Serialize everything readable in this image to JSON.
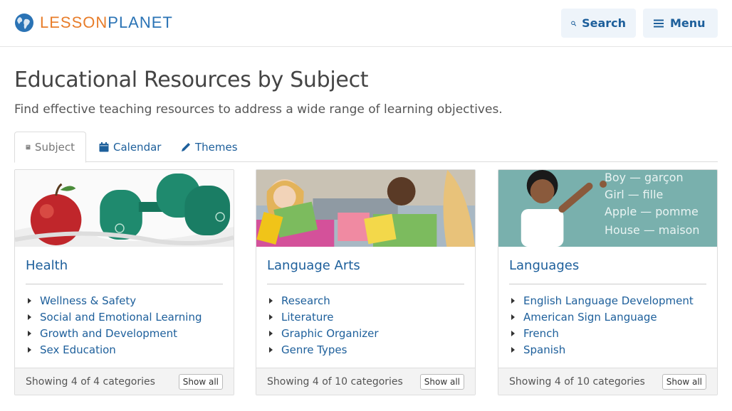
{
  "header": {
    "logo_word1": "LESSON",
    "logo_word2": "PLANET",
    "search_label": "Search",
    "menu_label": "Menu"
  },
  "page": {
    "title": "Educational Resources by Subject",
    "subtitle": "Find effective teaching resources to address a wide range of learning objectives."
  },
  "tabs": [
    {
      "label": "Subject",
      "active": true
    },
    {
      "label": "Calendar",
      "active": false
    },
    {
      "label": "Themes",
      "active": false
    }
  ],
  "cards": [
    {
      "title": "Health",
      "items": [
        "Wellness & Safety",
        "Social and Emotional Learning",
        "Growth and Development",
        "Sex Education"
      ],
      "footer": "Showing 4 of 4 categories",
      "button": "Show all"
    },
    {
      "title": "Language Arts",
      "items": [
        "Research",
        "Literature",
        "Graphic Organizer",
        "Genre Types"
      ],
      "footer": "Showing 4 of 10 categories",
      "button": "Show all"
    },
    {
      "title": "Languages",
      "items": [
        "English Language Development",
        "American Sign Language",
        "French",
        "Spanish"
      ],
      "footer": "Showing 4 of 10 categories",
      "button": "Show all",
      "image_text": [
        "Boy — garçon",
        "Girl — fille",
        "Apple — pomme",
        "House — maison"
      ]
    }
  ],
  "colors": {
    "link": "#1d5f9b",
    "logo_orange": "#e87d2a",
    "logo_blue": "#2a73b5",
    "button_bg": "#eef4fa"
  }
}
